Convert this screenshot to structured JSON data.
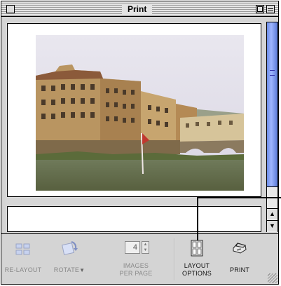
{
  "window": {
    "title": "Print"
  },
  "toolbar": {
    "relayout": {
      "label": "RE-LAYOUT",
      "icon": "relayout-icon",
      "enabled": false
    },
    "rotate": {
      "label": "ROTATE",
      "icon": "rotate-icon",
      "enabled": false
    },
    "images_per_page": {
      "label_line1": "IMAGES",
      "label_line2": "PER PAGE",
      "value": "4",
      "enabled": false
    },
    "layout_options": {
      "label_line1": "LAYOUT",
      "label_line2": "OPTIONS",
      "icon": "layout-grid-icon",
      "enabled": true
    },
    "print": {
      "label": "PRINT",
      "icon": "printer-icon",
      "enabled": true
    }
  },
  "colors": {
    "scroll_thumb": "#7f9cf5",
    "window_bg": "#d4d4d4",
    "disabled_text": "#8a8a8a"
  }
}
